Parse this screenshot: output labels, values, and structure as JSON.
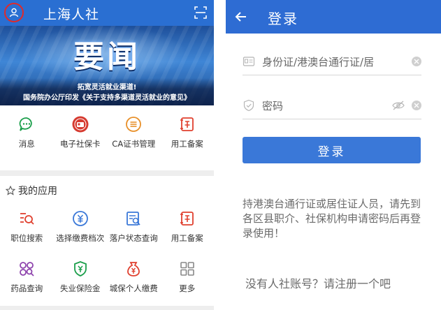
{
  "left_screen": {
    "header": {
      "title": "上海人社"
    },
    "banner": {
      "headline": "要闻",
      "line1": "拓宽灵活就业渠道!",
      "line2": "国务院办公厅印发《关于支持多渠道灵活就业的意见》"
    },
    "quick_actions": [
      {
        "label": "消息",
        "icon": "message-icon",
        "color": "#1a9e4a"
      },
      {
        "label": "电子社保卡",
        "icon": "social-security-card-icon",
        "color": "#d63a2f"
      },
      {
        "label": "CA证书管理",
        "icon": "ca-certificate-icon",
        "color": "#e8902a"
      },
      {
        "label": "用工备案",
        "icon": "employment-record-icon",
        "color": "#e0402f"
      }
    ],
    "my_apps": {
      "title": "我的应用",
      "items": [
        {
          "label": "职位搜索",
          "icon": "job-search-icon",
          "color": "#e0402f"
        },
        {
          "label": "选择缴费档次",
          "icon": "payment-level-icon",
          "color": "#3a78d8"
        },
        {
          "label": "落户状态查询",
          "icon": "settlement-query-icon",
          "color": "#3a78d8"
        },
        {
          "label": "用工备案",
          "icon": "employment-record-icon",
          "color": "#e0402f"
        },
        {
          "label": "药品查询",
          "icon": "drug-query-icon",
          "color": "#8e44ad"
        },
        {
          "label": "失业保险金",
          "icon": "unemployment-insurance-icon",
          "color": "#1a9e4a"
        },
        {
          "label": "城保个人缴费",
          "icon": "personal-payment-icon",
          "color": "#e0402f"
        },
        {
          "label": "更多",
          "icon": "more-grid-icon",
          "color": "#888888"
        }
      ]
    }
  },
  "right_screen": {
    "header": {
      "title": "登录"
    },
    "id_field": {
      "placeholder": "身份证/港澳台通行证/居"
    },
    "password_field": {
      "placeholder": "密码"
    },
    "login_button": "登录",
    "notice": "持港澳台通行证或居住证人员，请先到各区县职介、社保机构申请密码后再登录使用！",
    "register_link": "没有人社账号？请注册一个吧"
  },
  "colors": {
    "header_blue": "#2a6fd2",
    "login_blue": "#3a78d8",
    "highlight_red": "#e02a2a"
  }
}
